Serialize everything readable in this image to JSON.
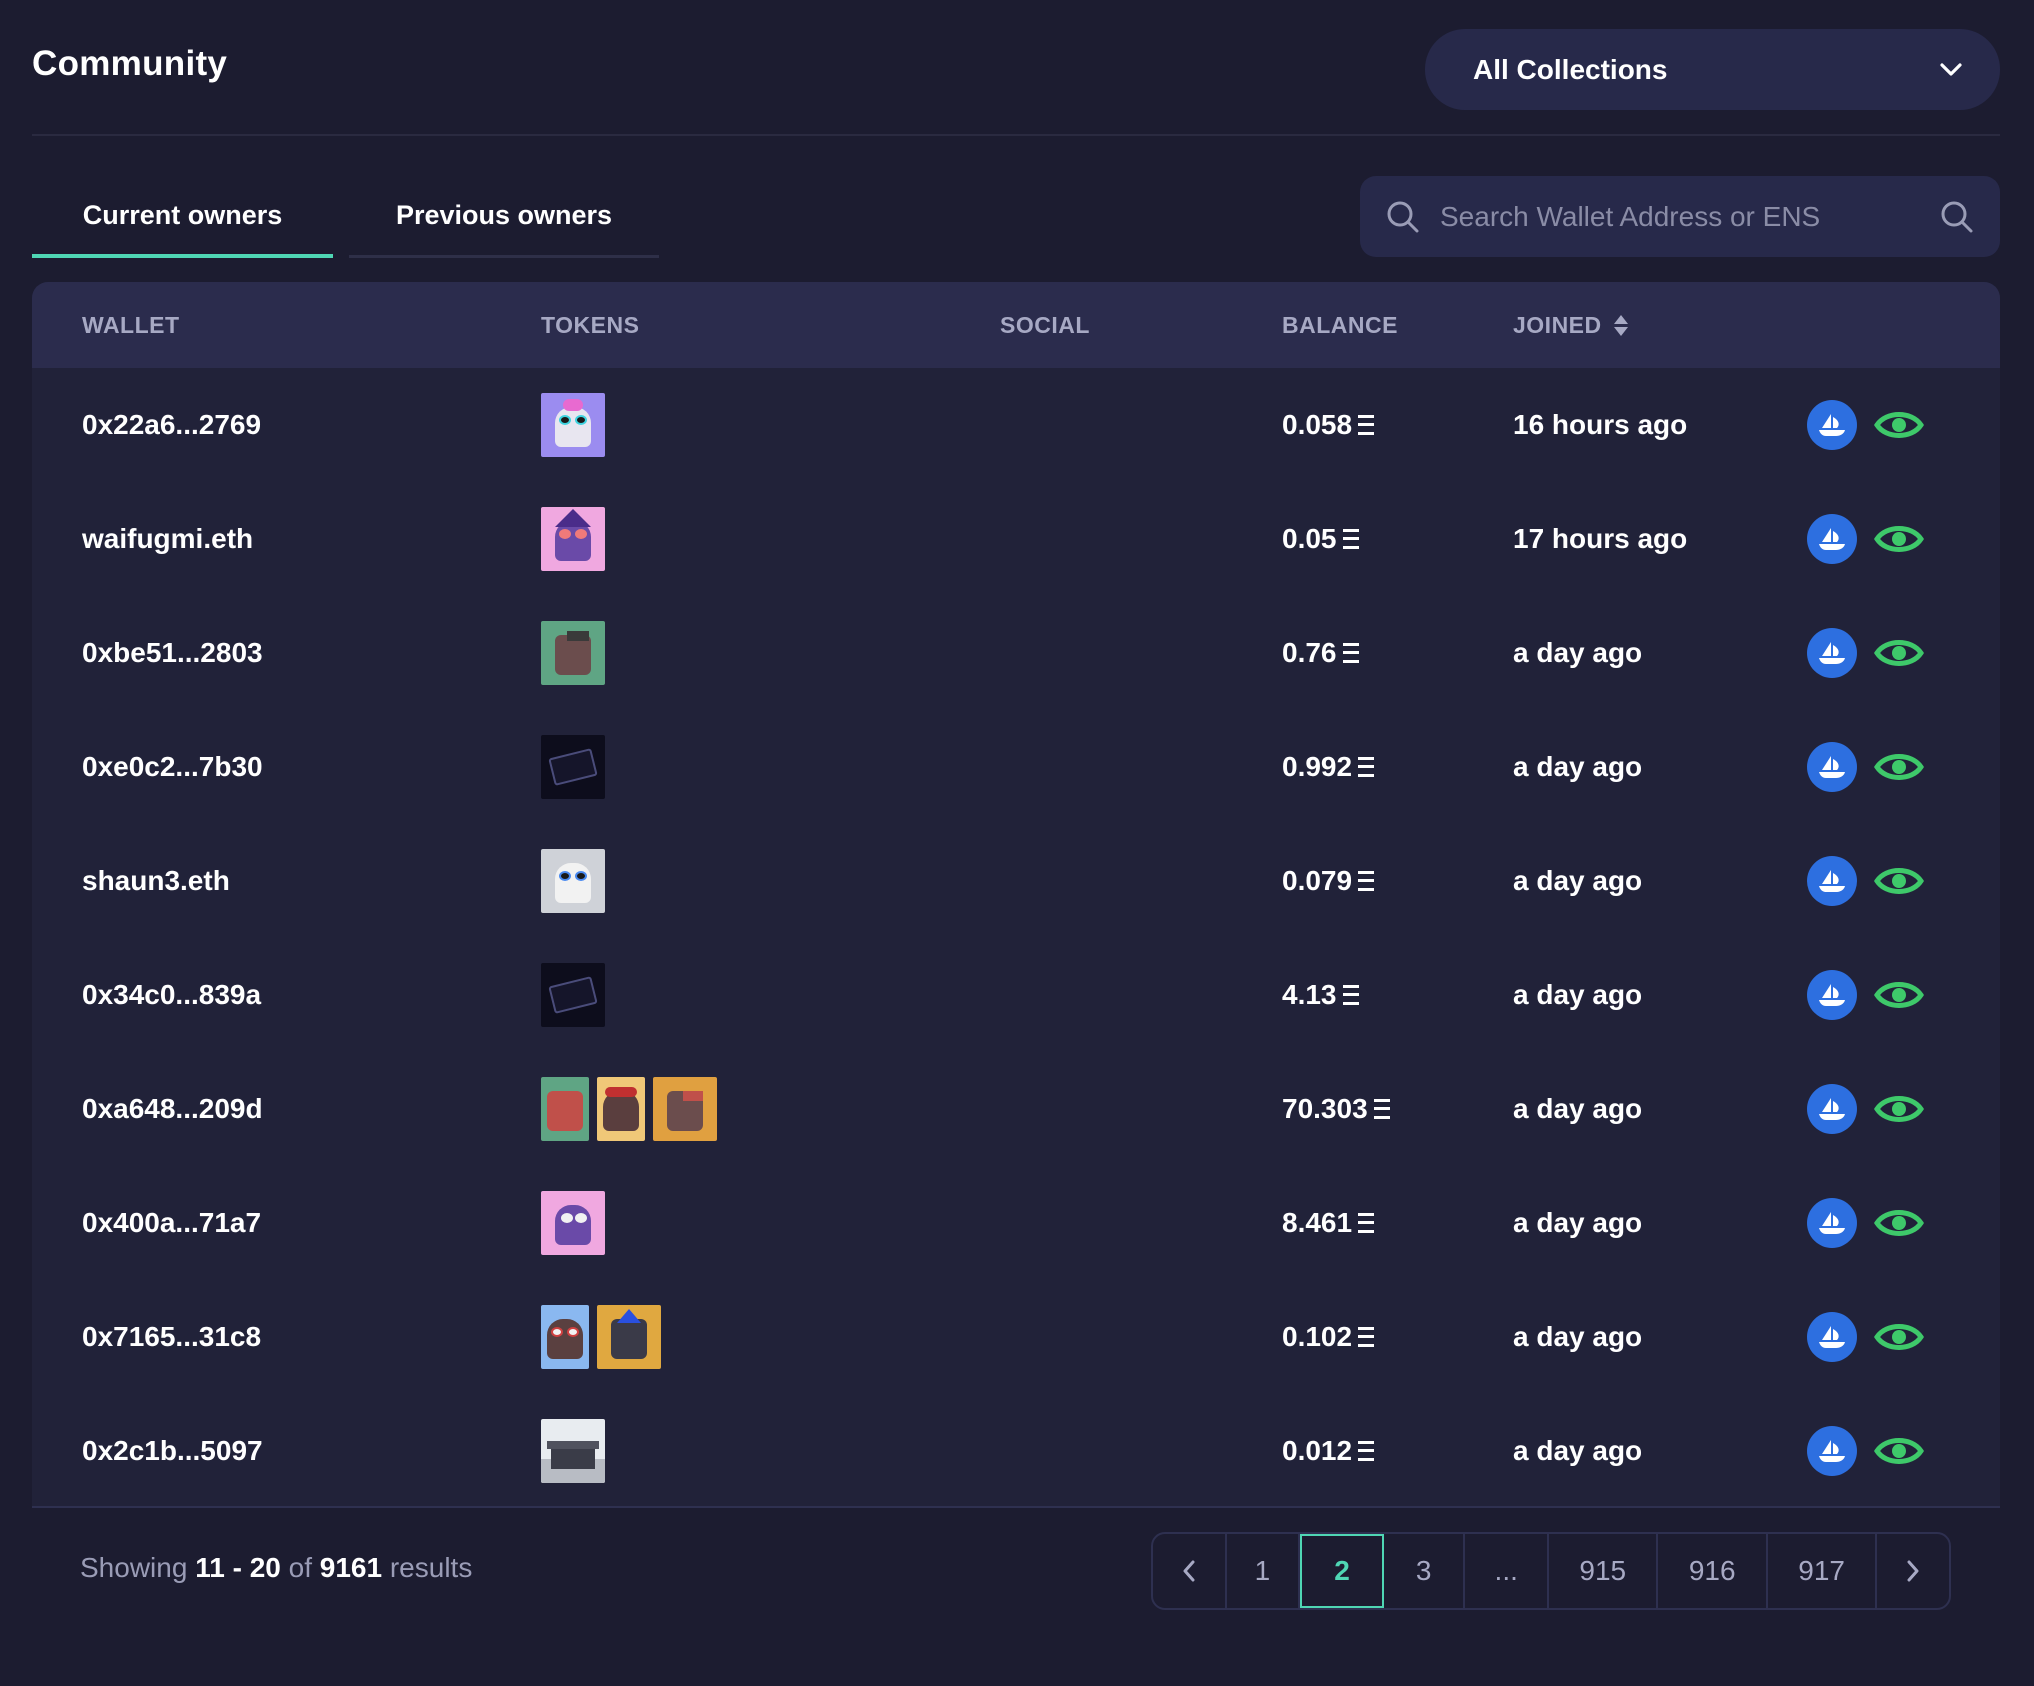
{
  "header": {
    "title": "Community",
    "collection_select": "All Collections"
  },
  "tabs": [
    {
      "label": "Current owners",
      "active": true
    },
    {
      "label": "Previous owners",
      "active": false
    }
  ],
  "search": {
    "placeholder": "Search Wallet Address or ENS"
  },
  "table": {
    "columns": [
      "WALLET",
      "TOKENS",
      "SOCIAL",
      "BALANCE",
      "JOINED"
    ],
    "rows": [
      {
        "wallet": "0x22a6...2769",
        "balance": "0.058",
        "joined": "16 hours ago"
      },
      {
        "wallet": "waifugmi.eth",
        "balance": "0.05",
        "joined": "17 hours ago"
      },
      {
        "wallet": "0xbe51...2803",
        "balance": "0.76",
        "joined": "a day ago"
      },
      {
        "wallet": "0xe0c2...7b30",
        "balance": "0.992",
        "joined": "a day ago"
      },
      {
        "wallet": "shaun3.eth",
        "balance": "0.079",
        "joined": "a day ago"
      },
      {
        "wallet": "0x34c0...839a",
        "balance": "4.13",
        "joined": "a day ago"
      },
      {
        "wallet": "0xa648...209d",
        "balance": "70.303",
        "joined": "a day ago"
      },
      {
        "wallet": "0x400a...71a7",
        "balance": "8.461",
        "joined": "a day ago"
      },
      {
        "wallet": "0x7165...31c8",
        "balance": "0.102",
        "joined": "a day ago"
      },
      {
        "wallet": "0x2c1b...5097",
        "balance": "0.012",
        "joined": "a day ago"
      }
    ]
  },
  "footer": {
    "showing_prefix": "Showing",
    "range_start": "11",
    "range_sep": "-",
    "range_end": "20",
    "of_label": "of",
    "total": "9161",
    "results_label": "results"
  },
  "pagination": {
    "prev_icon": "chevron-left-icon",
    "pages": [
      "1",
      "2",
      "3",
      "...",
      "915",
      "916",
      "917"
    ],
    "active_page": "2",
    "next_icon": "chevron-right-icon"
  },
  "colors": {
    "background": "#1c1c30",
    "accent": "#4fd6b4",
    "opensea_blue": "#2d6fe0",
    "eye_green": "#3ec96a"
  }
}
